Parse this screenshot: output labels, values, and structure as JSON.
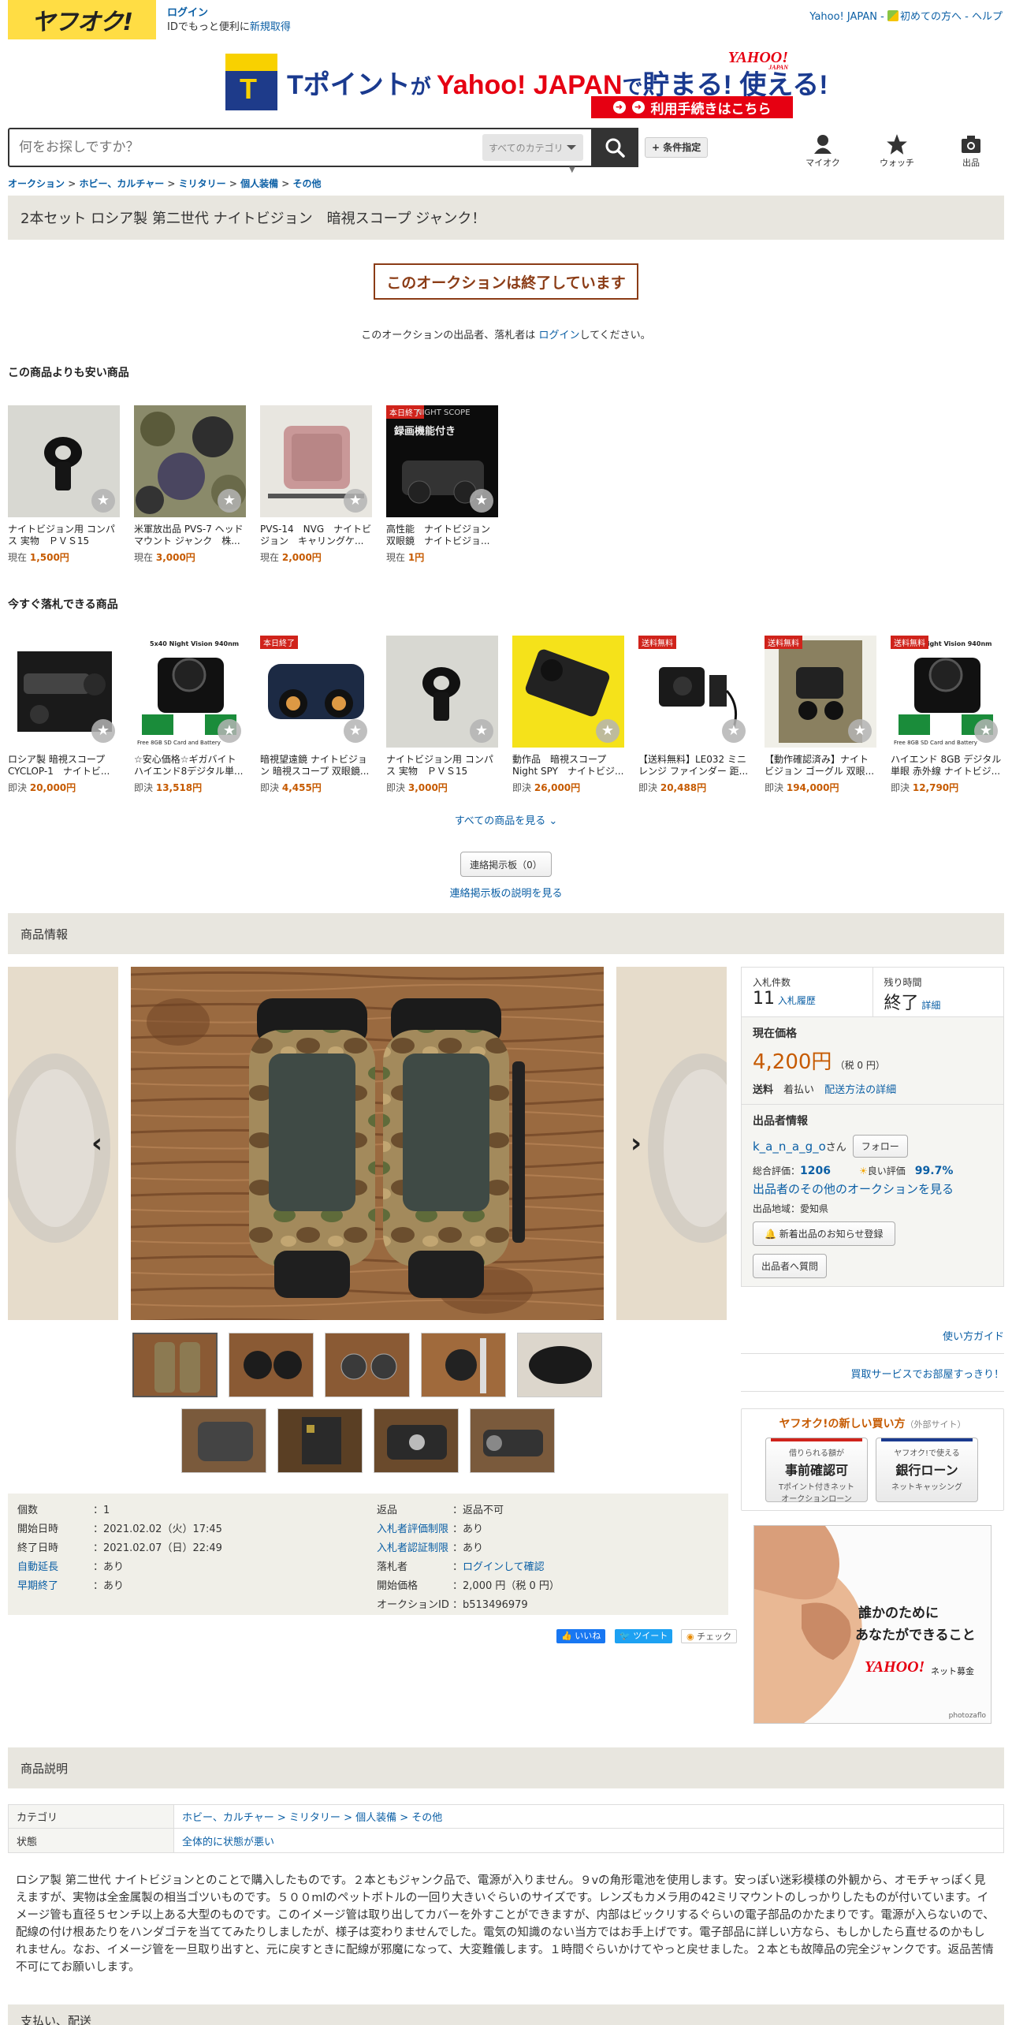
{
  "header": {
    "logo_text": "ヤフオク!",
    "login": "ログイン",
    "login_sub": "IDでもっと便利に",
    "register": "新規取得",
    "top_links": [
      "Yahoo! JAPAN",
      "初めての方へ",
      "ヘルプ"
    ],
    "sep": " - "
  },
  "banner": {
    "t": "T",
    "text_part1": "Tポイント",
    "text_part2": "が ",
    "text_part3": "Yahoo! JAPAN",
    "text_part4": "で",
    "text_part5": "貯まる! 使える!",
    "yahoo_logo": "YAHOO!",
    "yahoo_sub": "JAPAN",
    "cta": "利用手続きはこちら"
  },
  "search": {
    "placeholder": "何をお探しですか？",
    "category": "すべてのカテゴリ",
    "conditions": "+ 条件指定"
  },
  "nav": [
    {
      "label": "マイオク"
    },
    {
      "label": "ウォッチ"
    },
    {
      "label": "出品"
    }
  ],
  "breadcrumb": [
    "オークション",
    "ホビー、カルチャー",
    "ミリタリー",
    "個人装備",
    "その他"
  ],
  "title": "2本セット ロシア製 第二世代 ナイトビジョン　暗視スコープ ジャンク！",
  "ended": "このオークションは終了しています",
  "login_msg": {
    "pre": "このオークションの出品者、落札者は ",
    "link": "ログイン",
    "post": "してください。"
  },
  "cheaper": {
    "label": "この商品よりも安い商品",
    "items": [
      {
        "name": "ナイトビジョン用 コンパス 実物　ＰＶＳ15",
        "price_label": "現在",
        "price": "1,500円"
      },
      {
        "name": "米軍放出品 PVS-7 ヘッドマウント ジャンク　株...",
        "price_label": "現在",
        "price": "3,000円"
      },
      {
        "name": "PVS-14　NVG　ナイトビジョン　キャリングケ...",
        "price_label": "現在",
        "price": "2,000円"
      },
      {
        "name": "高性能　ナイトビジョン　双眼鏡　ナイトビジョ...",
        "price_label": "現在",
        "price": "1円",
        "tag": "本日終了",
        "img_text": "NIGHT SCOPE",
        "img_text2": "録画機能付き"
      }
    ]
  },
  "buynow": {
    "label": "今すぐ落札できる商品",
    "items": [
      {
        "name": "ロシア製 暗視スコープ CYCLOP-1　ナイトビ...",
        "price_label": "即決",
        "price": "20,000円"
      },
      {
        "name": "☆安心価格☆ギガバイト ハイエンド8デジタル単...",
        "price_label": "即決",
        "price": "13,518円",
        "img_text": "5x40 Night Vision 940nm",
        "img_text2": "Free 8GB SD Card and Battery"
      },
      {
        "name": "暗視望遠鏡 ナイトビジョン 暗視スコープ 双眼鏡...",
        "price_label": "即決",
        "price": "4,455円",
        "tag": "本日終了"
      },
      {
        "name": "ナイトビジョン用 コンパス 実物　ＰＶＳ15",
        "price_label": "即決",
        "price": "3,000円"
      },
      {
        "name": "動作品　暗視スコープ Night SPY　ナイトビジ...",
        "price_label": "即決",
        "price": "26,000円"
      },
      {
        "name": "【送料無料】LE032 ミニレンジ ファインダー 距...",
        "price_label": "即決",
        "price": "20,488円",
        "tag": "送料無料"
      },
      {
        "name": "【動作確認済み】ナイトビジョン ゴーグル 双眼...",
        "price_label": "即決",
        "price": "194,000円",
        "tag": "送料無料"
      },
      {
        "name": "ハイエンド 8GB デジタル単眼 赤外線 ナイトビジ...",
        "price_label": "即決",
        "price": "12,790円",
        "tag": "送料無料",
        "img_text": "Night Vision 940nm",
        "img_text2": "Free 8GB SD Card and Battery"
      }
    ],
    "see_all": "すべての商品を見る"
  },
  "board": {
    "button": "連絡掲示板（0）",
    "link": "連絡掲示板の説明を見る"
  },
  "product_info_label": "商品情報",
  "panel": {
    "bids_label": "入札件数",
    "bids": "11",
    "bid_history": "入札履歴",
    "time_label": "残り時間",
    "time": "終了",
    "detail": "詳細",
    "current_price_label": "現在価格",
    "price": "4,200円",
    "tax": "（税 0 円）",
    "shipping_label": "送料",
    "shipping": "着払い",
    "shipping_link": "配送方法の詳細",
    "seller_label": "出品者情報",
    "seller_name": "k_a_n_a_g_o",
    "seller_suffix": "さん",
    "follow": "フォロー",
    "rating_label": "総合評価：",
    "rating": "1206",
    "good_label": "良い評価",
    "good": "99.7%",
    "other_auctions": "出品者のその他のオークションを見る",
    "region": "出品地域：愛知県",
    "notify": "新着出品のお知らせ登録",
    "ask": "出品者へ質問"
  },
  "guides": {
    "usage": "使い方ガイド",
    "trouble": "買取サービスでお部屋すっきり！"
  },
  "newbuy": {
    "title": "ヤフオク!の新しい買い方",
    "title_sub": "（外部サイト）",
    "btn1_small": "借りられる額が",
    "btn1_big": "事前確認可",
    "btn1_sub1": "Tポイント付きネット",
    "btn1_sub2": "オークションローン",
    "btn2_small": "ヤフオク!で使える",
    "btn2_big": "銀行ローン",
    "btn2_sub": "ネットキャッシング"
  },
  "ad": {
    "line1": "誰かのために",
    "line2": "あなたができること",
    "brand": "YAHOO!",
    "brand_sub": "JAPAN",
    "brand_suffix": "ネット募金",
    "credit": "photozaflo"
  },
  "info": {
    "left": [
      {
        "k": "個数",
        "v": "1",
        "link": false
      },
      {
        "k": "開始日時",
        "v": "2021.02.02（火）17:45",
        "link": false
      },
      {
        "k": "終了日時",
        "v": "2021.02.07（日）22:49",
        "link": false
      },
      {
        "k": "自動延長",
        "v": "あり",
        "link": true
      },
      {
        "k": "早期終了",
        "v": "あり",
        "link": true
      }
    ],
    "right": [
      {
        "k": "返品",
        "v": "返品不可",
        "link": false
      },
      {
        "k": "入札者評価制限",
        "v": "あり",
        "link": true
      },
      {
        "k": "入札者認証制限",
        "v": "あり",
        "link": true
      },
      {
        "k": "落札者",
        "v": "ログインして確認",
        "link": false,
        "vlink": true
      },
      {
        "k": "開始価格",
        "v": "2,000 円（税 0 円）",
        "link": false
      },
      {
        "k": "オークションID",
        "v": "b513496979",
        "link": false
      }
    ]
  },
  "social": {
    "like": "いいね",
    "tweet": "ツイート",
    "check": "チェック"
  },
  "description_label": "商品説明",
  "category_table": {
    "cat_label": "カテゴリ",
    "cat_path": [
      "ホビー、カルチャー",
      "ミリタリー",
      "個人装備",
      "その他"
    ],
    "state_label": "状態",
    "state": "全体的に状態が悪い"
  },
  "description": "ロシア製 第二世代 ナイトビジョンとのことで購入したものです。２本ともジャンク品で、電源が入りません。９vの角形電池を使用します。安っぽい迷彩模様の外観から、オモチャっぽく見えますが、実物は全金属製の相当ゴツいものです。５００mlのペットボトルの一回り大きいぐらいのサイズです。レンズもカメラ用の42ミリマウントのしっかりしたものが付いています。イメージ管も直径５センチ以上ある大型のものです。このイメージ管は取り出してカバーを外すことができますが、内部はビックリするぐらいの電子部品のかたまりです。電源が入らないので、配線の付け根あたりをハンダゴテを当ててみたりしましたが、様子は変わりませんでした。電気の知識のない当方ではお手上げです。電子部品に詳しい方なら、もしかしたら直せるのかもしれません。なお、イメージ管を一旦取り出すと、元に戻すときに配線が邪魔になって、大変難儀します。１時間ぐらいかけてやっと戻せました。２本とも故障品の完全ジャンクです。返品苦情不可にてお願いします。",
  "next_section": "支払い、配送",
  "colors": {
    "accent_price": "#c65a00",
    "link": "#0b5fa5",
    "ended_border": "#8b3c16",
    "logo_yellow": "#ffdd44"
  }
}
